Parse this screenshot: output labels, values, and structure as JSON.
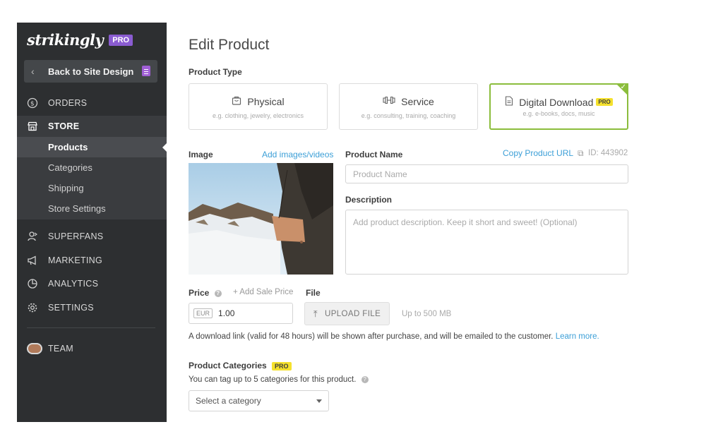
{
  "sidebar": {
    "logo": "strikingly",
    "pro_badge": "PRO",
    "back_label": "Back to Site Design",
    "nav": {
      "orders": "ORDERS",
      "store": "STORE",
      "superfans": "SUPERFANS",
      "marketing": "MARKETING",
      "analytics": "ANALYTICS",
      "settings": "SETTINGS",
      "team": "TEAM"
    },
    "store_sub": [
      "Products",
      "Categories",
      "Shipping",
      "Store Settings"
    ]
  },
  "main": {
    "title": "Edit Product",
    "product_type_label": "Product Type",
    "product_types": [
      {
        "name": "Physical",
        "sub": "e.g. clothing, jewelry, electronics"
      },
      {
        "name": "Service",
        "sub": "e.g. consulting, training, coaching"
      },
      {
        "name": "Digital Download",
        "sub": "e.g. e-books, docs, music",
        "badge": "PRO",
        "selected": true
      }
    ],
    "image_label": "Image",
    "add_images_link": "Add images/videos",
    "product_name_label": "Product Name",
    "copy_url_link": "Copy Product URL",
    "product_id": "ID: 443902",
    "product_name_placeholder": "Product Name",
    "description_label": "Description",
    "description_placeholder": "Add product description. Keep it short and sweet! (Optional)",
    "price_label": "Price",
    "add_sale_price": "+ Add Sale Price",
    "file_label": "File",
    "currency": "EUR",
    "price_value": "1.00",
    "upload_label": "UPLOAD FILE",
    "upload_limit": "Up to 500 MB",
    "download_note": "A download link (valid for 48 hours) will be shown after purchase, and will be emailed to the customer.",
    "learn_more": "Learn more.",
    "categories_label": "Product Categories",
    "categories_badge": "PRO",
    "categories_note": "You can tag up to 5 categories for this product.",
    "category_select": "Select a category"
  },
  "colors": {
    "sidebar_bg": "#2d2f31",
    "pro_purple": "#8a5cd1",
    "pro_yellow": "#f5e12d",
    "selected_green": "#8bbd3c",
    "link_blue": "#3c9fd7"
  }
}
